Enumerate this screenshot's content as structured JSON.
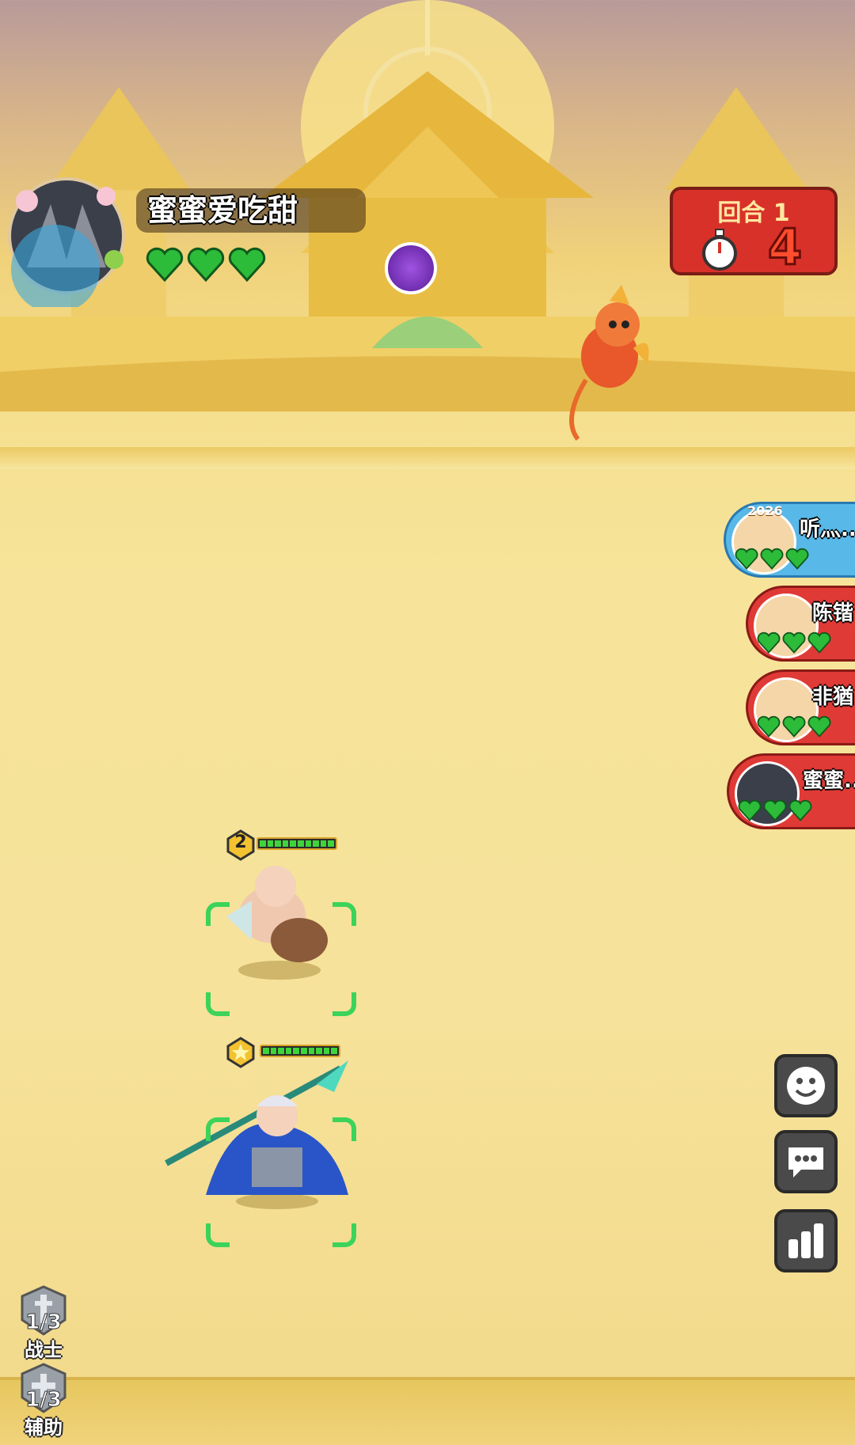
{
  "player": {
    "name": "蜜蜜爱吃甜",
    "hearts": 3
  },
  "round": {
    "label": "回合 1",
    "timer": "4"
  },
  "opponents": [
    {
      "name": "听灬..",
      "hearts": 3,
      "bg": "#58b8e8",
      "badge": "2026"
    },
    {
      "name": "陈锴",
      "hearts": 3,
      "bg": "#e03a36",
      "badge": ""
    },
    {
      "name": "非猶",
      "hearts": 3,
      "bg": "#e03a36",
      "badge": ""
    },
    {
      "name": "蜜蜜..",
      "hearts": 3,
      "bg": "#e03a36",
      "badge": ""
    }
  ],
  "units": [
    {
      "level": "2",
      "hp_fraction": 1.0
    },
    {
      "level": "",
      "hp_fraction": 1.0
    }
  ],
  "roles": [
    {
      "count": "1/3",
      "name": "战士"
    },
    {
      "count": "1/3",
      "name": "辅助"
    }
  ],
  "colors": {
    "heart": "#2dbb3a",
    "round_panel": "#d8312a",
    "selection": "#3bd35a"
  },
  "icons": {
    "skill": "purple-flame-icon",
    "emoji_button": "smiley-icon",
    "chat_button": "chat-bubble-icon",
    "stats_button": "bar-chart-icon"
  }
}
